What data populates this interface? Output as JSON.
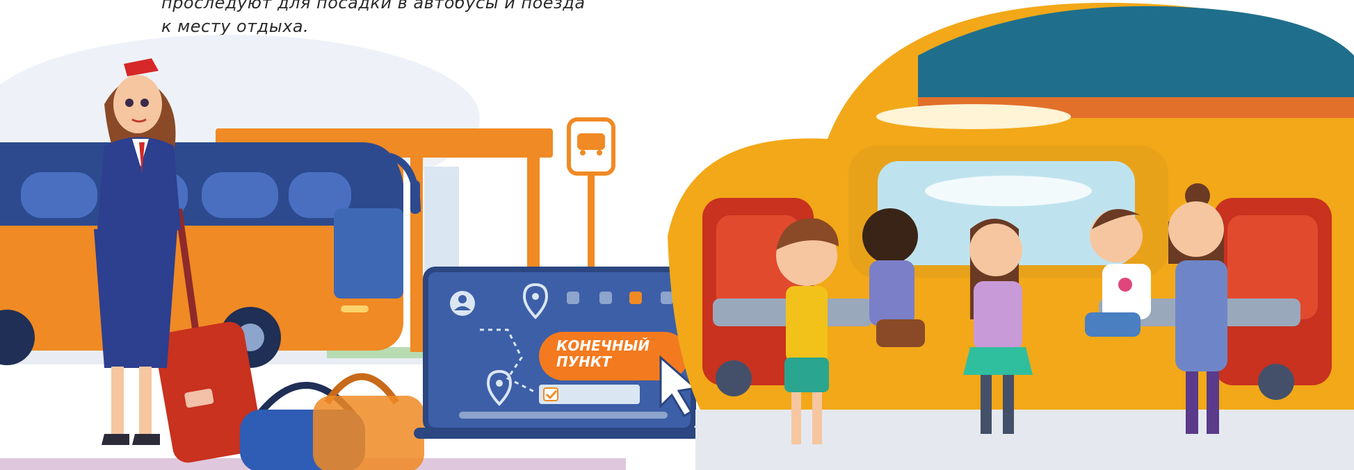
{
  "caption": {
    "line1": "проследуют для посадки в автобусы и поезда",
    "line2": "к месту отдыха."
  },
  "laptop": {
    "button_line1": "КОНЕЧНЫЙ",
    "button_line2": "ПУНКТ"
  },
  "icons": [
    "bus-stop-sign-icon",
    "user-icon",
    "location-pin-icon",
    "cursor-arrow-icon",
    "checkbox-checked-icon"
  ],
  "colors": {
    "bus_blue": "#2d4a8f",
    "bus_orange": "#f08a24",
    "train_orange": "#f2a818",
    "train_teal": "#1f6f8c",
    "seat_red": "#c8321e",
    "laptop_blue": "#3d5fa8",
    "accent_orange": "#f47a1f"
  }
}
